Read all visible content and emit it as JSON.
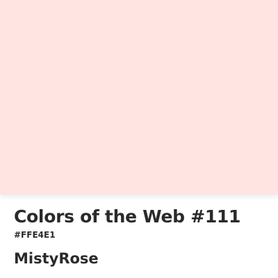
{
  "swatch": {
    "color": "#FFE4E1"
  },
  "title": "Colors of the Web #111",
  "hex_code": "#FFE4E1",
  "color_name": "MistyRose",
  "text_color": "#2A2A2A"
}
